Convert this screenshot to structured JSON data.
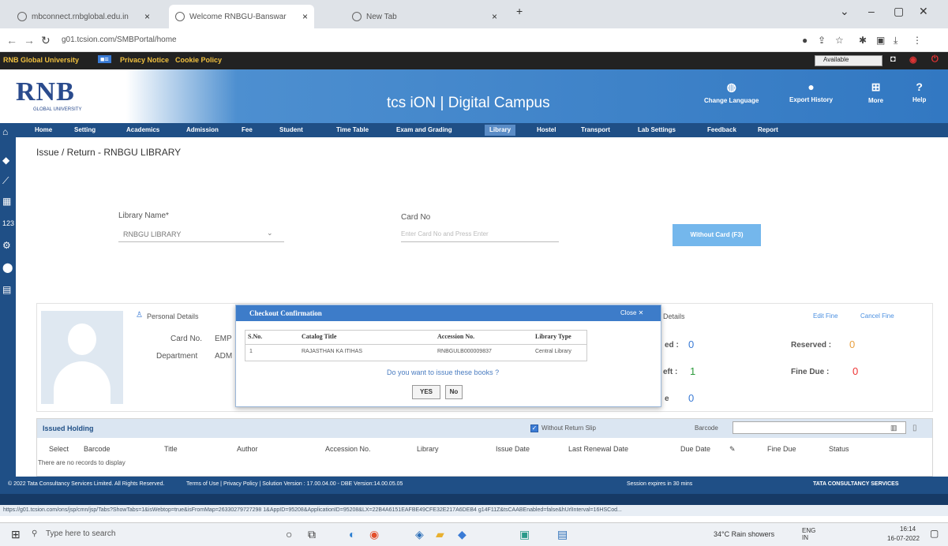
{
  "browser": {
    "tabs": [
      "mbconnect.rnbglobal.edu.in",
      "Welcome RNBGU-Banswar",
      "New Tab"
    ],
    "url": "g01.tcsion.com/SMBPortal/home",
    "status_url": "https://g01.tcsion.com/ons/jsp/cmn/jsp/Tabs?ShowTabs=1&isWebtop=true&isFromMap=26330279727298 1&AppID=95208&ApplicationID=95208&LX=22B4A6151EAFBE49CFE32E217A6DEB4 g14F11Z&tsCAABEnabled=false&hUrlInterval=16HSCod..."
  },
  "topstrip": {
    "university": "RNB Global University",
    "links": [
      "Privacy Notice",
      "Cookie Policy"
    ],
    "availability": "Available"
  },
  "header": {
    "logo": "RNB",
    "logo_sub": "GLOBAL UNIVERSITY",
    "brand": "tcs iON | Digital Campus",
    "actions": [
      "Change Language",
      "Export History",
      "More",
      "Help"
    ]
  },
  "menu": [
    "Home",
    "Setting",
    "Academics",
    "Admission",
    "Fee",
    "Student",
    "Time Table",
    "Exam and Grading",
    "Library",
    "Hostel",
    "Transport",
    "Lab Settings",
    "Feedback",
    "Report"
  ],
  "page": {
    "title": "Issue / Return - RNBGU LIBRARY",
    "library_label": "Library Name*",
    "library_value": "RNBGU LIBRARY",
    "card_label": "Card No",
    "card_placeholder": "Enter Card No and Press Enter",
    "without_card_btn": "Without Card (F3)"
  },
  "patron": {
    "section": "Personal Details",
    "card_label": "Card No.",
    "card_value": "EMP",
    "dept_label": "Department",
    "dept_value": "ADM",
    "details": "Details",
    "edit_fine": "Edit Fine",
    "cancel_fine": "Cancel Fine",
    "issued_label": "ed :",
    "issued_value": "0",
    "left_label": "eft :",
    "left_value": "1",
    "third_label": "e",
    "third_value": "0",
    "reserved_label": "Reserved :",
    "reserved_value": "0",
    "fine_label": "Fine Due :",
    "fine_value": "0"
  },
  "holding": {
    "title": "Issued Holding",
    "without_return": "Without Return Slip",
    "barcode_label": "Barcode",
    "columns": [
      "Select",
      "Barcode",
      "Title",
      "Author",
      "Accession No.",
      "Library",
      "Issue Date",
      "Last Renewal Date",
      "Due Date",
      "Fine Due",
      "Status"
    ],
    "empty_text": "There are no records to display"
  },
  "footer": {
    "copyright": "© 2022 Tata Consultancy Services Limited. All Rights Reserved.",
    "links": "Terms of Use | Privacy Policy | Solution Version : 17.00.04.00 - DBE Version:14.00.05.05",
    "session": "Session expires in 30 mins",
    "tcs": "TATA CONSULTANCY SERVICES"
  },
  "modal": {
    "title": "Checkout Confirmation",
    "close": "Close",
    "headers": [
      "S.No.",
      "Catalog Title",
      "Accession No.",
      "Library Type"
    ],
    "row": [
      "1",
      "RAJASTHAN KA ITIHAS",
      "RNBGULB000009837",
      "Central Library"
    ],
    "question": "Do you want to issue these books ?",
    "yes": "YES",
    "no": "No"
  },
  "taskbar": {
    "search": "Type here to search",
    "weather": "34°C  Rain showers",
    "lang": "ENG IN",
    "time": "16:14",
    "date": "16-07-2022"
  }
}
